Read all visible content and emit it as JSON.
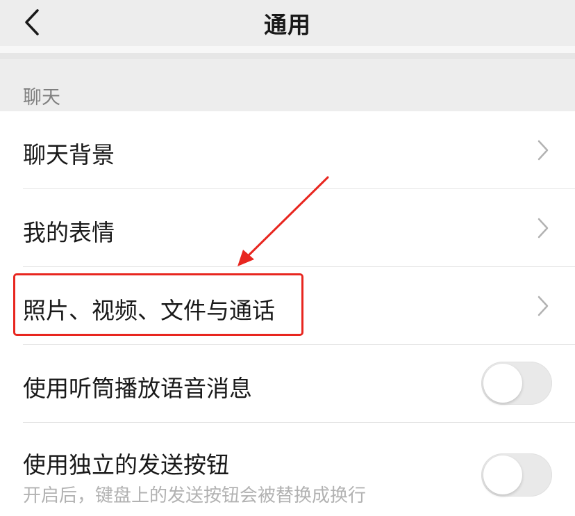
{
  "header": {
    "title": "通用",
    "back_icon": "chevron-left-icon"
  },
  "section": {
    "label": "聊天"
  },
  "rows": [
    {
      "label": "聊天背景",
      "type": "link"
    },
    {
      "label": "我的表情",
      "type": "link"
    },
    {
      "label": "照片、视频、文件与通话",
      "type": "link",
      "highlighted": true
    },
    {
      "label": "使用听筒播放语音消息",
      "type": "toggle",
      "on": false
    },
    {
      "label": "使用独立的发送按钮",
      "sub": "开启后，键盘上的发送按钮会被替换成换行",
      "type": "toggle",
      "on": false
    }
  ],
  "colors": {
    "background": "#ededed",
    "list_bg": "#ffffff",
    "annotation": "#e8261f",
    "chevron": "#b2b2b2",
    "subtitle": "#b2b2b2"
  }
}
